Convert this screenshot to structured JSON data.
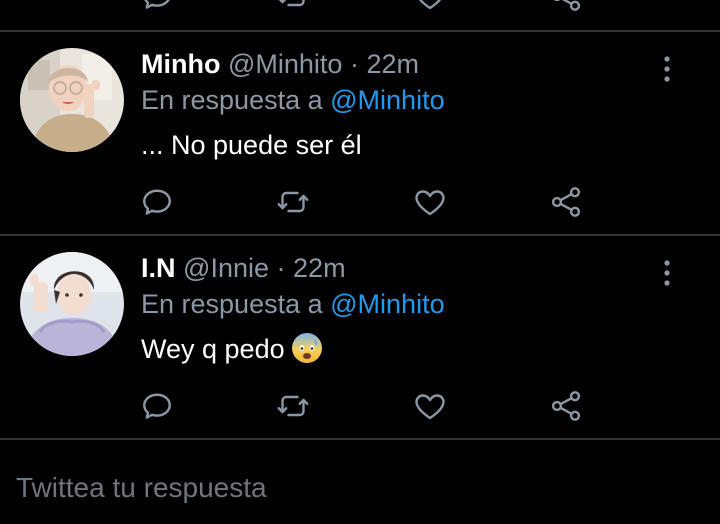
{
  "colors": {
    "background": "#000000",
    "divider": "#2f3336",
    "muted": "#8b98a5",
    "mention": "#1d9bf0",
    "text": "#ffffff",
    "icon": "#8b98a5"
  },
  "icons": {
    "reply": "speech-bubble-icon",
    "retweet": "retweet-arrows-icon",
    "like": "heart-outline-icon",
    "share": "share-nodes-icon",
    "more": "vertical-ellipsis-icon",
    "emoji": "anxious-face-with-sweat-emoji"
  },
  "tweets": [
    {
      "name": "Minho",
      "handle": "@Minhito",
      "separator": "·",
      "time": "22m",
      "reply_prefix": "En respuesta a",
      "reply_to": "@Minhito",
      "text": "... No puede ser él"
    },
    {
      "name": "I.N",
      "handle": "@Innie",
      "separator": "·",
      "time": "22m",
      "reply_prefix": "En respuesta a",
      "reply_to": "@Minhito",
      "text": "Wey q pedo"
    }
  ],
  "composer": {
    "placeholder": "Twittea tu respuesta"
  }
}
